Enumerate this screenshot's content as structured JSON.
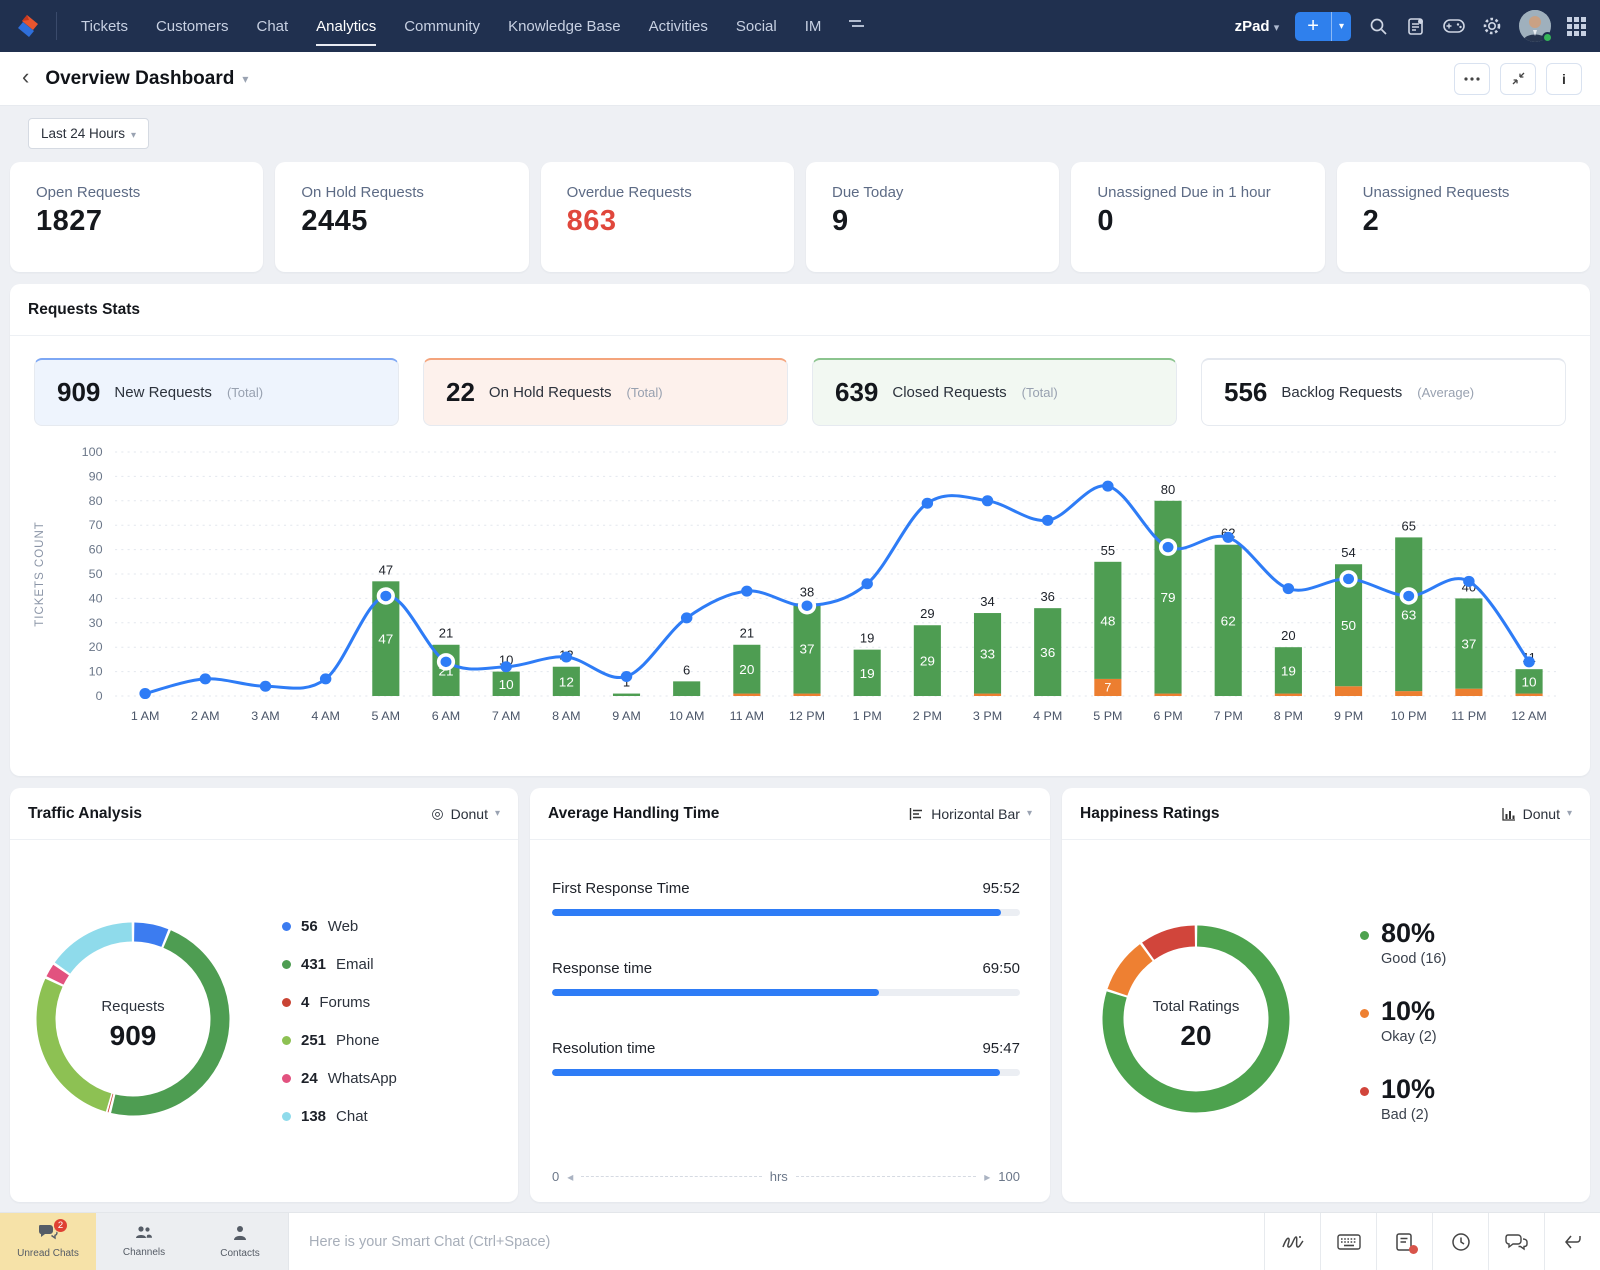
{
  "nav": {
    "brand": "zoho-desk",
    "items": [
      {
        "label": "Tickets",
        "active": false
      },
      {
        "label": "Customers",
        "active": false
      },
      {
        "label": "Chat",
        "active": false
      },
      {
        "label": "Analytics",
        "active": true
      },
      {
        "label": "Community",
        "active": false
      },
      {
        "label": "Knowledge Base",
        "active": false
      },
      {
        "label": "Activities",
        "active": false
      },
      {
        "label": "Social",
        "active": false
      },
      {
        "label": "IM",
        "active": false
      }
    ],
    "product_switcher": "zPad",
    "add_label": "+"
  },
  "header": {
    "title": "Overview Dashboard"
  },
  "filter": {
    "label": "Last 24 Hours"
  },
  "stat_cards": [
    {
      "label": "Open Requests",
      "value": "1827",
      "color": "#15181d"
    },
    {
      "label": "On Hold Requests",
      "value": "2445",
      "color": "#15181d"
    },
    {
      "label": "Overdue Requests",
      "value": "863",
      "color": "#e0473c"
    },
    {
      "label": "Due Today",
      "value": "9",
      "color": "#15181d"
    },
    {
      "label": "Unassigned Due in 1 hour",
      "value": "0",
      "color": "#15181d"
    },
    {
      "label": "Unassigned Requests",
      "value": "2",
      "color": "#15181d"
    }
  ],
  "requests_stats": {
    "title": "Requests Stats",
    "tiles": [
      {
        "value": "909",
        "label": "New Requests",
        "suffix": "(Total)",
        "bg": "#eef4fd",
        "border": "#7da7f4"
      },
      {
        "value": "22",
        "label": "On Hold Requests",
        "suffix": "(Total)",
        "bg": "#fdf1ec",
        "border": "#f4a47c"
      },
      {
        "value": "639",
        "label": "Closed Requests",
        "suffix": "(Total)",
        "bg": "#f2f8f2",
        "border": "#8bc48e"
      },
      {
        "value": "556",
        "label": "Backlog Requests",
        "suffix": "(Average)",
        "bg": "#ffffff",
        "border": "#e3e7ee"
      }
    ]
  },
  "chart_data": [
    {
      "id": "requests_stats_chart",
      "type": "bar",
      "subtype": "stacked-bars-with-line",
      "title": "Requests Stats",
      "ylabel": "TICKETS COUNT",
      "ylim": [
        0,
        100
      ],
      "ytick_step": 10,
      "grid": true,
      "categories": [
        "1 AM",
        "2 AM",
        "3 AM",
        "4 AM",
        "5 AM",
        "6 AM",
        "7 AM",
        "8 AM",
        "9 AM",
        "10 AM",
        "11 AM",
        "12 PM",
        "1 PM",
        "2 PM",
        "3 PM",
        "4 PM",
        "5 PM",
        "6 PM",
        "7 PM",
        "8 PM",
        "9 PM",
        "10 PM",
        "11 PM",
        "12 AM"
      ],
      "series": [
        {
          "name": "bar-green",
          "type": "bar",
          "color": "#4e9d52",
          "values": [
            0,
            0,
            0,
            0,
            47,
            21,
            10,
            12,
            1,
            6,
            20,
            37,
            19,
            29,
            33,
            36,
            48,
            79,
            62,
            19,
            50,
            63,
            37,
            10
          ]
        },
        {
          "name": "bar-orange",
          "type": "bar",
          "color": "#ec7e30",
          "values": [
            0,
            0,
            0,
            0,
            0,
            0,
            0,
            0,
            0,
            0,
            1,
            1,
            0,
            0,
            1,
            0,
            7,
            1,
            0,
            1,
            4,
            2,
            3,
            1
          ]
        },
        {
          "name": "line",
          "type": "line",
          "color": "#2e7cf6",
          "values": [
            1,
            7,
            4,
            7,
            41,
            14,
            12,
            16,
            8,
            32,
            43,
            37,
            46,
            79,
            80,
            72,
            86,
            61,
            65,
            44,
            48,
            41,
            47,
            14
          ]
        }
      ]
    },
    {
      "id": "traffic_analysis",
      "type": "pie",
      "subtype": "donut",
      "title": "Traffic Analysis",
      "view": "Donut",
      "center": {
        "label": "Requests",
        "value": "909"
      },
      "slices": [
        {
          "label": "Web",
          "value": 56,
          "color": "#3c7cf0"
        },
        {
          "label": "Email",
          "value": 431,
          "color": "#4e9d52"
        },
        {
          "label": "Forums",
          "value": 4,
          "color": "#c94434"
        },
        {
          "label": "Phone",
          "value": 251,
          "color": "#8dc153"
        },
        {
          "label": "WhatsApp",
          "value": 24,
          "color": "#e2527f"
        },
        {
          "label": "Chat",
          "value": 138,
          "color": "#8fdbeb"
        }
      ]
    },
    {
      "id": "average_handling_time",
      "type": "bar",
      "subtype": "horizontal",
      "title": "Average Handling Time",
      "view": "Horizontal Bar",
      "xlim": [
        0,
        100
      ],
      "xunit": "hrs",
      "bars": [
        {
          "label": "First Response Time",
          "value": "95:52",
          "pct": 95.9
        },
        {
          "label": "Response time",
          "value": "69:50",
          "pct": 69.8
        },
        {
          "label": "Resolution time",
          "value": "95:47",
          "pct": 95.8
        }
      ]
    },
    {
      "id": "happiness_ratings",
      "type": "pie",
      "subtype": "donut",
      "title": "Happiness Ratings",
      "view": "Donut",
      "center": {
        "label": "Total Ratings",
        "value": "20"
      },
      "slices": [
        {
          "label": "Good",
          "pct": "80%",
          "count": "(16)",
          "value": 80,
          "color": "#4da24e"
        },
        {
          "label": "Okay",
          "pct": "10%",
          "count": "(2)",
          "value": 10,
          "color": "#ee8032"
        },
        {
          "label": "Bad",
          "pct": "10%",
          "count": "(2)",
          "value": 10,
          "color": "#d1453b"
        }
      ]
    }
  ],
  "dock": {
    "tabs": [
      {
        "label": "Unread Chats",
        "icon": "chat-bubbles-icon",
        "badge": "2",
        "active": true
      },
      {
        "label": "Channels",
        "icon": "people-group-icon",
        "badge": "",
        "active": false
      },
      {
        "label": "Contacts",
        "icon": "person-icon",
        "badge": "",
        "active": false
      }
    ],
    "input_placeholder": "Here is your Smart Chat (Ctrl+Space)"
  }
}
